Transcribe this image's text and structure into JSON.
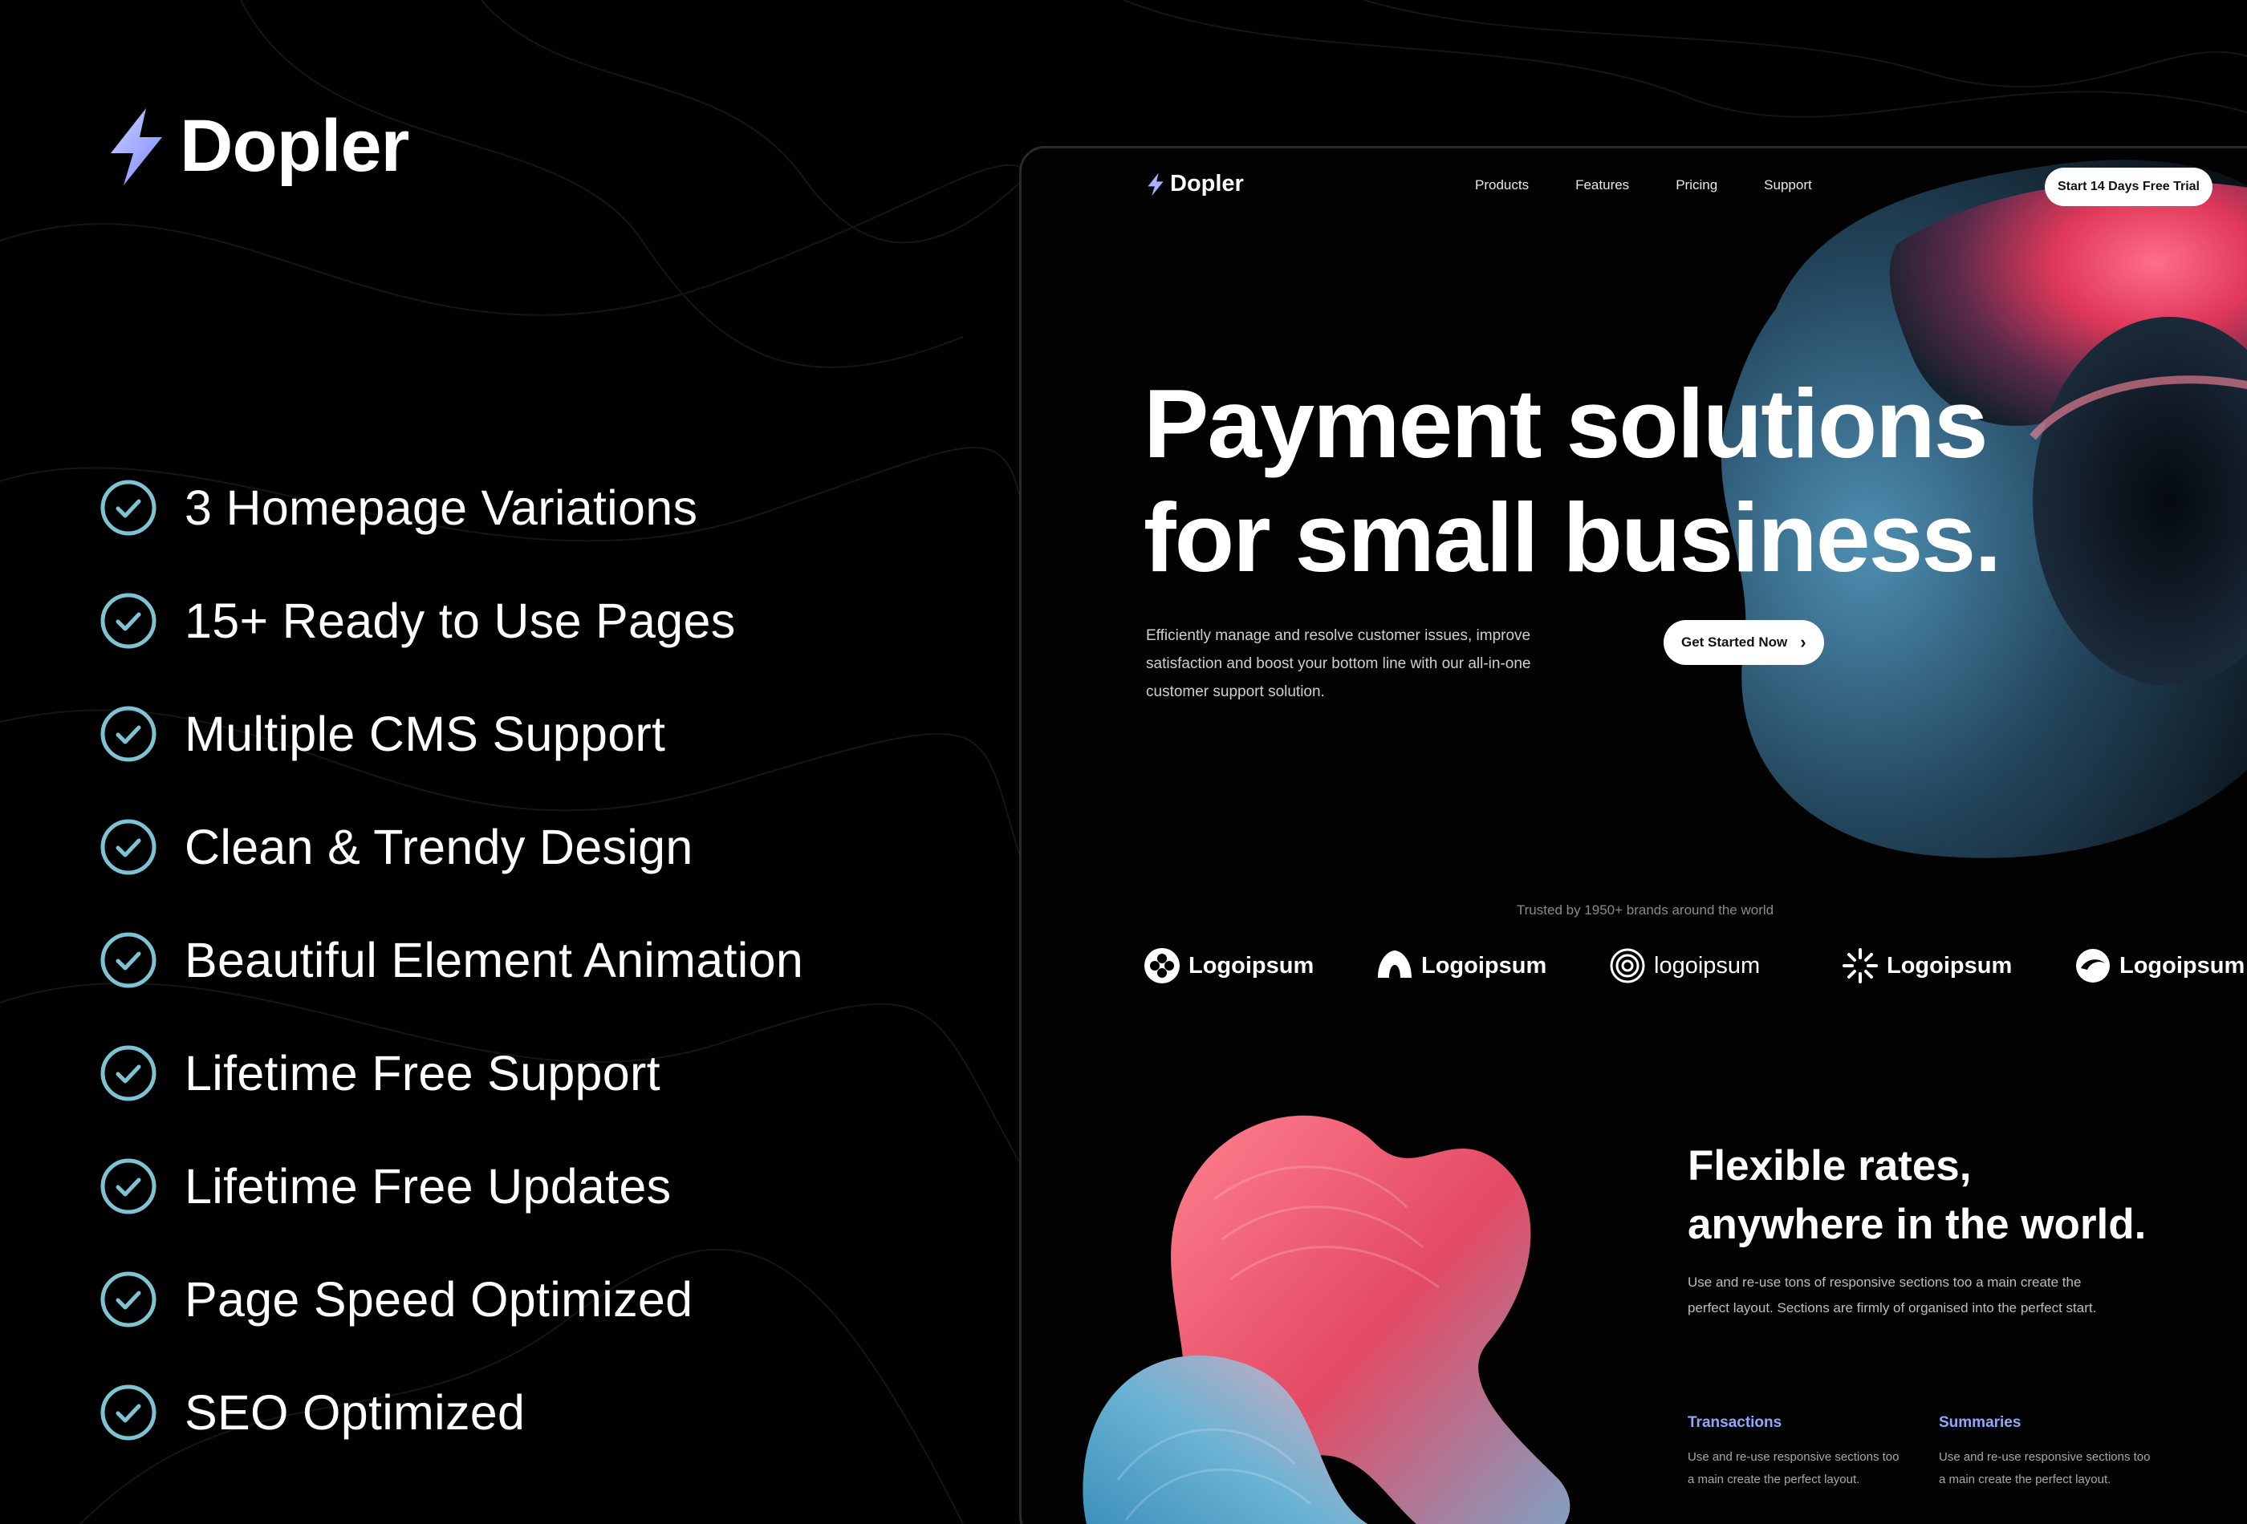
{
  "brand": {
    "name": "Dopler"
  },
  "features": [
    {
      "label": "3 Homepage Variations"
    },
    {
      "label": "15+ Ready to Use Pages"
    },
    {
      "label": "Multiple CMS Support"
    },
    {
      "label": "Clean & Trendy Design"
    },
    {
      "label": "Beautiful Element Animation"
    },
    {
      "label": "Lifetime Free Support"
    },
    {
      "label": "Lifetime Free Updates"
    },
    {
      "label": "Page Speed Optimized"
    },
    {
      "label": "SEO Optimized"
    }
  ],
  "preview": {
    "nav": {
      "logo": "Dopler",
      "items": [
        "Products",
        "Features",
        "Pricing",
        "Support"
      ],
      "cta": "Start 14 Days Free Trial"
    },
    "hero": {
      "title_line1": "Payment solutions",
      "title_line2": "for small business.",
      "subtitle": "Efficiently manage and resolve customer issues, improve satisfaction and boost your bottom line with our all-in-one customer support solution.",
      "cta": "Get Started Now",
      "cta_icon": "chevron-right-icon"
    },
    "trusted": {
      "text": "Trusted by 1950+ brands around the world",
      "logos": [
        "Logoipsum",
        "Logoipsum",
        "logoipsum",
        "Logoipsum",
        "Logoipsum"
      ]
    },
    "section": {
      "title_line1": "Flexible rates,",
      "title_line2": "anywhere in the world.",
      "subtitle": "Use and re-use tons of responsive sections too a main create the perfect layout. Sections are firmly of organised into the perfect start.",
      "columns": [
        {
          "title": "Transactions",
          "text": "Use and re-use responsive sections too a main create the perfect layout."
        },
        {
          "title": "Summaries",
          "text": "Use and re-use responsive sections too a main create the perfect layout."
        }
      ]
    }
  },
  "colors": {
    "background": "#000000",
    "check": "#7ec3d1",
    "bolt": "#a7b2ff",
    "accent_link": "#8fa8ff"
  }
}
